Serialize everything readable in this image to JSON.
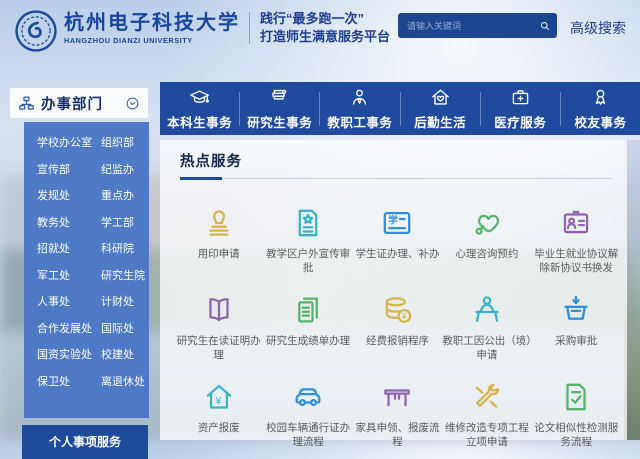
{
  "header": {
    "university_name_cn": "杭州电子科技大学",
    "university_name_en": "HANGZHOU DIANZI UNIVERSITY",
    "slogan_line1": "践行“最多跑一次”",
    "slogan_line2": "打造师生满意服务平台",
    "search": {
      "placeholder": "请输入关键词"
    },
    "advanced_search_label": "高级搜索"
  },
  "nav": {
    "tabs": [
      {
        "label": "本科生事务",
        "icon": "graduation-cap-icon"
      },
      {
        "label": "研究生事务",
        "icon": "books-icon"
      },
      {
        "label": "教职工事务",
        "icon": "staff-person-icon"
      },
      {
        "label": "后勤生活",
        "icon": "house-heart-icon"
      },
      {
        "label": "医疗服务",
        "icon": "medical-bag-icon"
      },
      {
        "label": "校友事务",
        "icon": "alumni-medal-icon"
      }
    ]
  },
  "sidebar": {
    "title": "办事部门",
    "departments": [
      "学校办公室",
      "组织部",
      "宣传部",
      "纪监办",
      "发规处",
      "重点办",
      "教务处",
      "学工部",
      "招就处",
      "科研院",
      "军工处",
      "研究生院",
      "人事处",
      "计财处",
      "合作发展处",
      "国际处",
      "国资实验处",
      "校建处",
      "保卫处",
      "离退休处"
    ],
    "bottom_panel_label": "个人事项服务"
  },
  "main": {
    "section_title": "热点服务",
    "services": [
      {
        "label": "用印申请",
        "icon": "seal-stamp-icon",
        "color": "#d9b44a"
      },
      {
        "label": "教学区户外宣传审批",
        "icon": "document-star-icon",
        "color": "#3ab3c9"
      },
      {
        "label": "学生证办理、补办",
        "icon": "student-card-icon",
        "color": "#2e8fdc"
      },
      {
        "label": "心理咨询预约",
        "icon": "heart-stethoscope-icon",
        "color": "#55b56a"
      },
      {
        "label": "毕业生就业协议解除新协议书换发",
        "icon": "id-badge-icon",
        "color": "#9263ae"
      },
      {
        "label": "研究生在读证明办理",
        "icon": "open-book-icon",
        "color": "#9263ae"
      },
      {
        "label": "研究生成绩单办理",
        "icon": "transcript-icon",
        "color": "#55b56a"
      },
      {
        "label": "经费报销程序",
        "icon": "coins-yuan-icon",
        "color": "#d9b44a"
      },
      {
        "label": "教职工因公出（境）申请",
        "icon": "person-desk-icon",
        "color": "#3ab3c9"
      },
      {
        "label": "采购审批",
        "icon": "basket-arrow-icon",
        "color": "#2e8fdc"
      },
      {
        "label": "资产报废",
        "icon": "house-yuan-icon",
        "color": "#3ab3c9"
      },
      {
        "label": "校园车辆通行证办理流程",
        "icon": "car-icon",
        "color": "#2e8fdc"
      },
      {
        "label": "家具申领、报废流程",
        "icon": "furniture-table-icon",
        "color": "#9263ae"
      },
      {
        "label": "维修改造专项工程立项申请",
        "icon": "tools-icon",
        "color": "#d9b44a"
      },
      {
        "label": "论文相似性检测服务流程",
        "icon": "document-check-icon",
        "color": "#55b56a"
      }
    ]
  },
  "colors": {
    "primary_blue": "#1f4a9e",
    "sidebar_blue": "#4a77c5",
    "deep_navy": "#14306b",
    "link_blue": "#1d3f94"
  }
}
